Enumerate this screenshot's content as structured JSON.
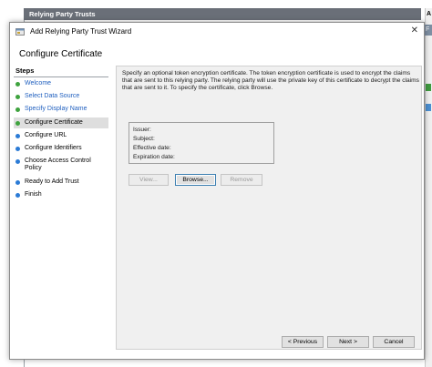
{
  "background": {
    "header_title": "Relying Party Trusts",
    "right_label_a": "A",
    "right_label_b": "F"
  },
  "window": {
    "title": "Add Relying Party Trust Wizard",
    "close_glyph": "✕"
  },
  "page": {
    "heading": "Configure Certificate"
  },
  "steps": {
    "title": "Steps",
    "items": [
      {
        "label": "Welcome",
        "state": "done"
      },
      {
        "label": "Select Data Source",
        "state": "done"
      },
      {
        "label": "Specify Display Name",
        "state": "done"
      },
      {
        "label": "Configure Certificate",
        "state": "current"
      },
      {
        "label": "Configure URL",
        "state": "todo"
      },
      {
        "label": "Configure Identifiers",
        "state": "todo"
      },
      {
        "label": "Choose Access Control Policy",
        "state": "todo"
      },
      {
        "label": "Ready to Add Trust",
        "state": "todo"
      },
      {
        "label": "Finish",
        "state": "todo"
      }
    ]
  },
  "content": {
    "description": "Specify an optional token encryption certificate.  The token encryption certificate is used to encrypt the claims that are sent to this relying party.  The relying party will use the private key of this certificate to decrypt the claims that are sent to it.  To specify the certificate, click Browse.",
    "certificate": {
      "issuer_label": "Issuer:",
      "subject_label": "Subject:",
      "effective_label": "Effective date:",
      "expiration_label": "Expiration date:"
    },
    "buttons": {
      "view": "View...",
      "browse": "Browse...",
      "remove": "Remove"
    }
  },
  "footer": {
    "previous": "< Previous",
    "next": "Next >",
    "cancel": "Cancel"
  },
  "colors": {
    "done_dot": "#3fa33f",
    "todo_dot": "#2b7bd6",
    "link_text": "#1f5fbf",
    "header_bg": "#6a6f78"
  }
}
